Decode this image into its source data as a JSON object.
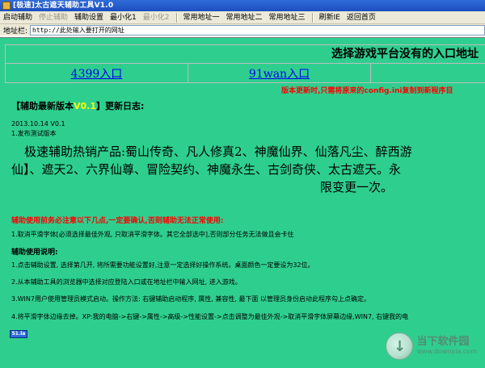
{
  "window": {
    "title": "[极速]太古遮天辅助工具V1.0"
  },
  "menubar": {
    "items": [
      {
        "label": "启动辅助",
        "enabled": true
      },
      {
        "label": "停止辅助",
        "enabled": false
      },
      {
        "label": "辅助设置",
        "enabled": true
      },
      {
        "label": "最小化1",
        "enabled": true
      },
      {
        "label": "最小化2",
        "enabled": false
      },
      {
        "label": "常用地址一",
        "enabled": true
      },
      {
        "label": "常用地址二",
        "enabled": true
      },
      {
        "label": "常用地址三",
        "enabled": true
      },
      {
        "label": "刷新IE",
        "enabled": true
      },
      {
        "label": "返回首页",
        "enabled": true
      }
    ]
  },
  "address": {
    "label": "地址栏:",
    "value": "http://此处输入要打开的网址"
  },
  "page": {
    "banner_title": "选择游戏平台没有的入口地址",
    "entries": [
      "4399入口",
      "91wan入口"
    ],
    "update_note": "版本更新时,只需将原来的config.ini复制到新程序目",
    "log_header": {
      "prefix": "【辅助最新版本",
      "version": "V0.1",
      "suffix": "】更新日志:"
    },
    "log_date": "2013.10.14 V0.1",
    "log_item": "1.发布测试版本",
    "promo": [
      "极速辅助热销产品:蜀山传奇、凡人修真2、神魔仙界、仙落凡尘、醉西游",
      "仙】、遮天2、六界仙尊、冒险契约、神魔永生、古剑奇侠、太古遮天。永",
      "限变更一次。"
    ],
    "warning": "辅助使用前务必注意以下几点,一定要确认,否则辅助无法正常使用:",
    "note1": "1.取消平滑字体[必须选择最佳外观, 只取消平滑字体。其它全部选中],否则部分任务无法做且会卡住",
    "usage_heading": "辅助使用说明:",
    "steps": [
      "1.点击辅助设置, 选择第几开, 将所需要功能设置好,注意一定选择好操作系统。桌面颜色一定要设为32位。",
      "2.从本辅助工具的浏览器中选择对应登陆入口或在地址栏中输入网址, 进入游戏。",
      "3.WIN7用户使用管理员模式启动。操作方法: 右键辅助启动程序, 属性, 兼容性, 最下面 以管理员身份启动此程序勾上点确定。",
      "4.将平滑字体边缘去掉。XP:我的电脑->右键->属性->高级->性能设置->点击调整为最佳外观->取消平滑字体屏幕边缘,WIN7, 右键我的电"
    ],
    "badge": "51.la",
    "watermark": {
      "cn": "当下软件园",
      "en": "www.downxia.com"
    }
  }
}
